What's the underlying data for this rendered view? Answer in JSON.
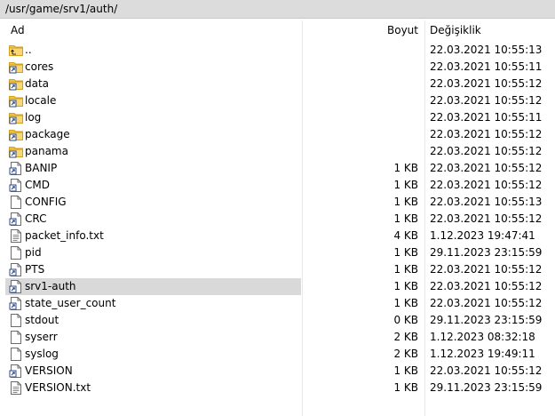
{
  "path": "/usr/game/srv1/auth/",
  "columns": {
    "name": "Ad",
    "size": "Boyut",
    "modified": "Değişiklik"
  },
  "rows": [
    {
      "name": "..",
      "size": "",
      "modified": "22.03.2021 10:55:13",
      "icon": "parent-folder-icon",
      "kind": "up"
    },
    {
      "name": "cores",
      "size": "",
      "modified": "22.03.2021 10:55:11",
      "icon": "folder-link-icon",
      "kind": "folder"
    },
    {
      "name": "data",
      "size": "",
      "modified": "22.03.2021 10:55:12",
      "icon": "folder-link-icon",
      "kind": "folder"
    },
    {
      "name": "locale",
      "size": "",
      "modified": "22.03.2021 10:55:12",
      "icon": "folder-link-icon",
      "kind": "folder"
    },
    {
      "name": "log",
      "size": "",
      "modified": "22.03.2021 10:55:11",
      "icon": "folder-link-icon",
      "kind": "folder"
    },
    {
      "name": "package",
      "size": "",
      "modified": "22.03.2021 10:55:12",
      "icon": "folder-link-icon",
      "kind": "folder"
    },
    {
      "name": "panama",
      "size": "",
      "modified": "22.03.2021 10:55:12",
      "icon": "folder-link-icon",
      "kind": "folder"
    },
    {
      "name": "BANIP",
      "size": "1 KB",
      "modified": "22.03.2021 10:55:12",
      "icon": "file-link-icon",
      "kind": "filelink"
    },
    {
      "name": "CMD",
      "size": "1 KB",
      "modified": "22.03.2021 10:55:12",
      "icon": "file-link-icon",
      "kind": "filelink"
    },
    {
      "name": "CONFIG",
      "size": "1 KB",
      "modified": "22.03.2021 10:55:13",
      "icon": "file-icon",
      "kind": "file"
    },
    {
      "name": "CRC",
      "size": "1 KB",
      "modified": "22.03.2021 10:55:12",
      "icon": "file-link-icon",
      "kind": "filelink"
    },
    {
      "name": "packet_info.txt",
      "size": "4 KB",
      "modified": "1.12.2023 19:47:41",
      "icon": "text-file-icon",
      "kind": "text"
    },
    {
      "name": "pid",
      "size": "1 KB",
      "modified": "29.11.2023 23:15:59",
      "icon": "file-icon",
      "kind": "file"
    },
    {
      "name": "PTS",
      "size": "1 KB",
      "modified": "22.03.2021 10:55:12",
      "icon": "file-link-icon",
      "kind": "filelink"
    },
    {
      "name": "srv1-auth",
      "size": "1 KB",
      "modified": "22.03.2021 10:55:12",
      "icon": "file-link-icon",
      "kind": "filelink",
      "selected": true
    },
    {
      "name": "state_user_count",
      "size": "1 KB",
      "modified": "22.03.2021 10:55:12",
      "icon": "file-link-icon",
      "kind": "filelink"
    },
    {
      "name": "stdout",
      "size": "0 KB",
      "modified": "29.11.2023 23:15:59",
      "icon": "file-icon",
      "kind": "file"
    },
    {
      "name": "syserr",
      "size": "2 KB",
      "modified": "1.12.2023 08:32:18",
      "icon": "file-icon",
      "kind": "file"
    },
    {
      "name": "syslog",
      "size": "2 KB",
      "modified": "1.12.2023 19:49:11",
      "icon": "file-icon",
      "kind": "file"
    },
    {
      "name": "VERSION",
      "size": "1 KB",
      "modified": "22.03.2021 10:55:12",
      "icon": "file-link-icon",
      "kind": "filelink"
    },
    {
      "name": "VERSION.txt",
      "size": "1 KB",
      "modified": "29.11.2023 23:15:59",
      "icon": "text-file-icon",
      "kind": "text"
    }
  ]
}
